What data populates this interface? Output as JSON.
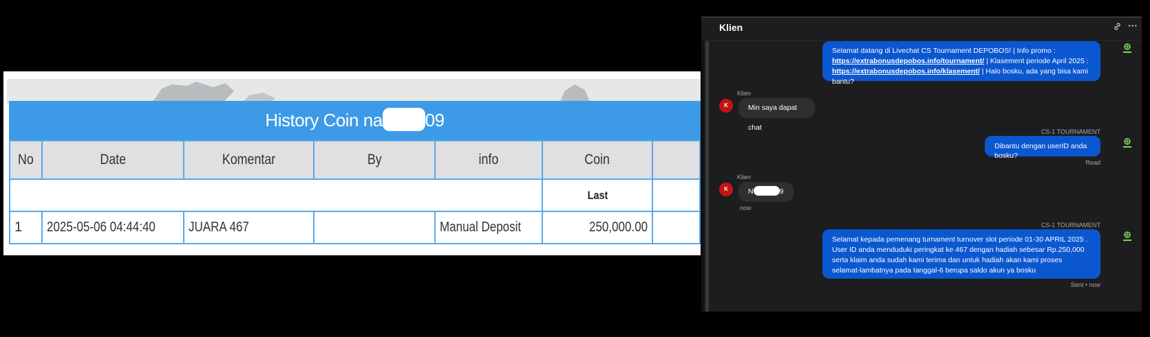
{
  "history": {
    "title_prefix": "History Coin na",
    "title_suffix": "09",
    "columns": [
      "No",
      "Date",
      "Komentar",
      "By",
      "info",
      "Coin"
    ],
    "sub_header_last": "Last",
    "rows": [
      {
        "no": "1",
        "date": "2025-05-06 04:44:40",
        "komentar": "JUARA 467",
        "by": "",
        "info": "Manual Deposit",
        "coin": "250,000.00"
      }
    ],
    "colors": {
      "title_bar": "#3d9ae6",
      "border": "#5aa6e6",
      "coin": "#2e7d32"
    }
  },
  "chat": {
    "header_title": "Klien",
    "header_icons": [
      "link-icon",
      "more-options-icon"
    ],
    "messages": [
      {
        "type": "agent",
        "sender": "CS-1 TOURNAMENT",
        "text_parts": [
          "Selamat datang di Livechat CS Tournament DEPOBOS! | Info promo :",
          "https://extrabonusdepobos.info/tournament/",
          " | Klasement periode April 2025 :",
          "https://extrabonusdepobos.info/klasement/",
          " | Halo bosku, ada yang bisa kami bantu?"
        ]
      },
      {
        "type": "client",
        "sender": "Klien",
        "avatar": "K",
        "text": "Min saya dapat chat"
      },
      {
        "type": "agent",
        "sender": "CS-1 TOURNAMENT",
        "text": "Dibantu dengan userID anda bosku?",
        "status": "Read"
      },
      {
        "type": "client",
        "sender": "Klien",
        "avatar": "K",
        "text_prefix": "N",
        "text_suffix": "9",
        "time": "now"
      },
      {
        "type": "agent",
        "sender": "CS-1 TOURNAMENT",
        "text": "Selamat kepada pemenang turnament turnover slot periode 01-30 APRIL 2025 . User ID anda menduduki peringkat ke 467 dengan hadiah sebesar Rp.250,000 serta klaim anda sudah kami terima dan untuk hadiah akan kami proses selamat-lambatnya pada tanggal-6 berupa saldo akun ya bosku",
        "status": "Sent • now"
      }
    ],
    "colors": {
      "agent_bubble": "#0b57d0",
      "client_bubble": "#2f2f31",
      "avatar": "#c41414",
      "background": "#1d1d1f"
    }
  }
}
